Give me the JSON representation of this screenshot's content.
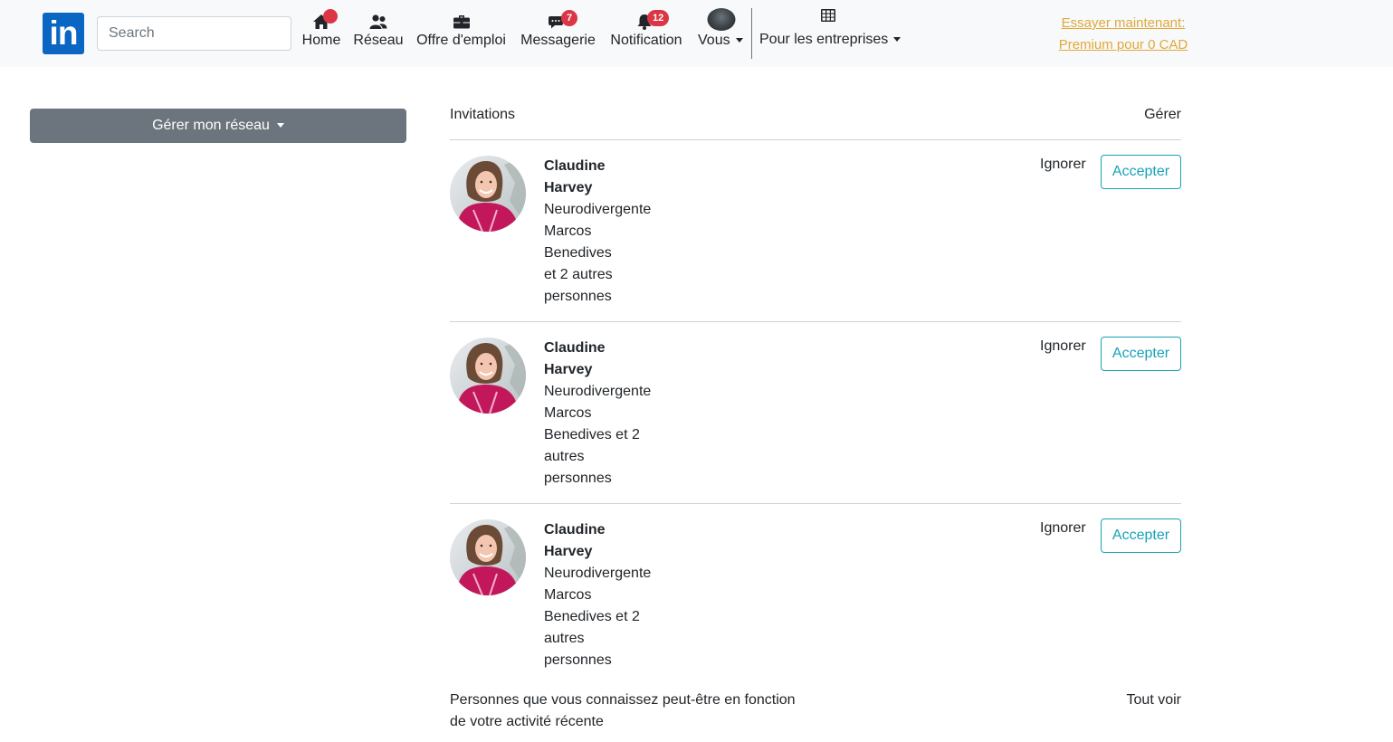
{
  "colors": {
    "brand": "#0a66c2",
    "badge": "#dc3545",
    "accept": "#17a2b8",
    "premium": "#e0a93a",
    "manage_button": "#6c757d"
  },
  "header": {
    "logo_text": "in",
    "search_placeholder": "Search",
    "nav": {
      "home": {
        "label": "Home",
        "icon": "home-icon"
      },
      "network": {
        "label": "Réseau",
        "icon": "people-icon"
      },
      "jobs": {
        "label": "Offre d'emploi",
        "icon": "briefcase-icon"
      },
      "messaging": {
        "label": "Messagerie",
        "icon": "chat-icon",
        "badge": "7"
      },
      "notifications": {
        "label": "Notification",
        "icon": "bell-icon",
        "badge": "12"
      },
      "me": {
        "label": "Vous",
        "icon": "avatar"
      },
      "business": {
        "label": "Pour les entreprises",
        "icon": "grid-icon"
      }
    },
    "premium": {
      "line1": "Essayer maintenant:",
      "line2": "Premium pour 0 CAD"
    }
  },
  "sidebar": {
    "manage_label": "Gérer mon réseau"
  },
  "main": {
    "invitations_title": "Invitations",
    "manage_link": "Gérer",
    "invitations": [
      {
        "first_name": "Claudine",
        "last_name": "Harvey",
        "lines": [
          "Neurodivergente",
          "Marcos",
          "Benedives",
          "et 2 autres",
          "personnes"
        ],
        "ignore_label": "Ignorer",
        "accept_label": "Accepter"
      },
      {
        "first_name": "Claudine",
        "last_name": "Harvey",
        "lines": [
          "Neurodivergente",
          "Marcos",
          "Benedives et 2",
          "autres",
          "personnes"
        ],
        "ignore_label": "Ignorer",
        "accept_label": "Accepter"
      },
      {
        "first_name": "Claudine",
        "last_name": "Harvey",
        "lines": [
          "Neurodivergente",
          "Marcos",
          "Benedives et 2",
          "autres",
          "personnes"
        ],
        "ignore_label": "Ignorer",
        "accept_label": "Accepter"
      }
    ],
    "suggestions_text": "Personnes que vous connaissez peut-être en fonction de votre activité récente",
    "see_all": "Tout voir"
  }
}
